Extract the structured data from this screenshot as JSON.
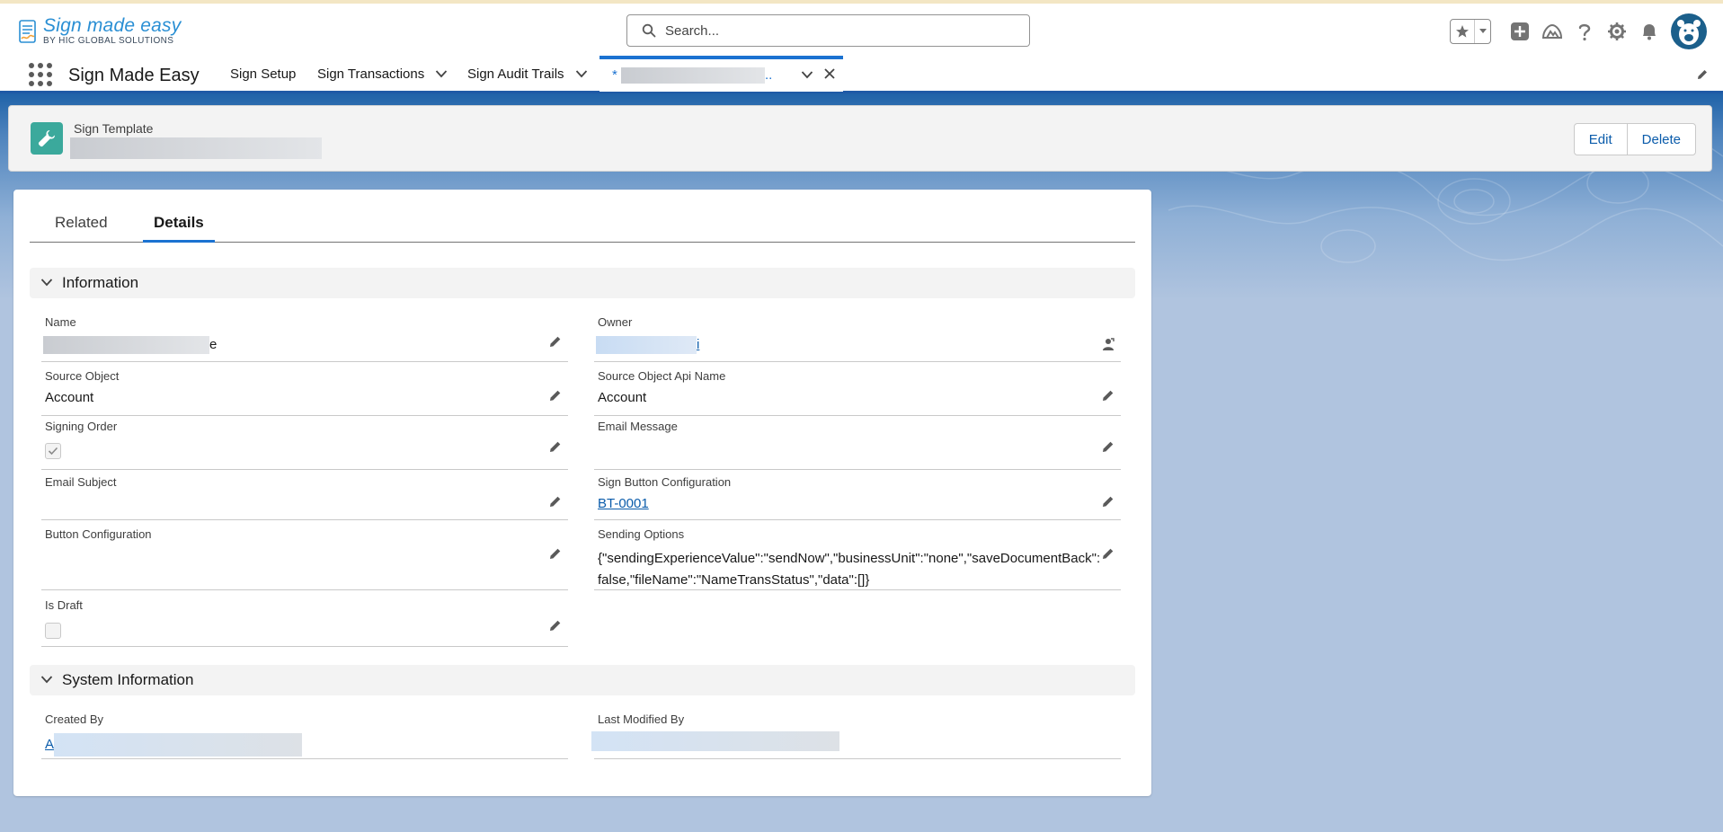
{
  "logo": {
    "main": "Sign made easy",
    "sub": "BY HIC GLOBAL SOLUTIONS"
  },
  "search": {
    "placeholder": "Search..."
  },
  "header_icons": [
    "favorites-star-icon",
    "favorites-dropdown-icon",
    "global-actions-add-icon",
    "trailhead-icon",
    "help-icon",
    "setup-gear-icon",
    "notifications-bell-icon",
    "user-avatar"
  ],
  "nav": {
    "app_name": "Sign Made Easy",
    "items": [
      {
        "label": "Sign Setup",
        "has_menu": false
      },
      {
        "label": "Sign Transactions",
        "has_menu": true
      },
      {
        "label": "Sign Audit Trails",
        "has_menu": true
      }
    ],
    "active_tab": {
      "prefix": "* ",
      "suffix": ".."
    }
  },
  "highlights": {
    "object_type": "Sign Template",
    "buttons": {
      "edit": "Edit",
      "delete": "Delete"
    }
  },
  "tabs": {
    "related": "Related",
    "details": "Details",
    "active": "Details"
  },
  "sections": {
    "information": "Information",
    "system_information": "System Information"
  },
  "fields": {
    "name": {
      "label": "Name",
      "value_suffix": "e"
    },
    "owner": {
      "label": "Owner",
      "value_suffix": "i"
    },
    "source_object": {
      "label": "Source Object",
      "value": "Account"
    },
    "source_object_api_name": {
      "label": "Source Object Api Name",
      "value": "Account"
    },
    "signing_order": {
      "label": "Signing Order",
      "checked": true
    },
    "email_message": {
      "label": "Email Message",
      "value": ""
    },
    "email_subject": {
      "label": "Email Subject",
      "value": ""
    },
    "sign_button_configuration": {
      "label": "Sign Button Configuration",
      "value": "BT-0001"
    },
    "button_configuration": {
      "label": "Button Configuration",
      "value": ""
    },
    "sending_options": {
      "label": "Sending Options",
      "value": "{\"sendingExperienceValue\":\"sendNow\",\"businessUnit\":\"none\",\"saveDocumentBack\":false,\"fileName\":\"NameTransStatus\",\"data\":[]}"
    },
    "is_draft": {
      "label": "Is Draft",
      "checked": false
    },
    "created_by": {
      "label": "Created By",
      "value_prefix": "A"
    },
    "last_modified_by": {
      "label": "Last Modified By"
    }
  },
  "colors": {
    "brand_blue": "#1b72d1",
    "link": "#0b5cab",
    "template_icon": "#3ba99c",
    "nav_underline": "#1f5aa6"
  }
}
